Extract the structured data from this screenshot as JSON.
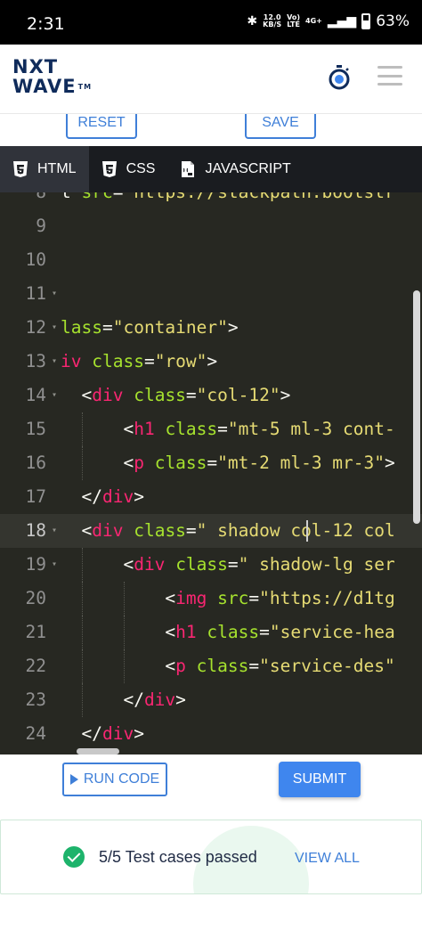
{
  "status_bar": {
    "time": "2:31",
    "net_speed_value": "12.0",
    "net_speed_unit": "KB/S",
    "volte_top": "Vo)",
    "volte_bottom": "LTE",
    "network": "4G+",
    "battery": "63%"
  },
  "header": {
    "logo_top": "NXT",
    "logo_bottom": "WAVE",
    "logo_tm": "TM"
  },
  "actions": {
    "reset_label": "RESET",
    "save_label": "SAVE"
  },
  "tabs": [
    {
      "label": "HTML",
      "icon": "html5-icon",
      "active": true
    },
    {
      "label": "CSS",
      "icon": "css3-icon",
      "active": false
    },
    {
      "label": "JAVASCRIPT",
      "icon": "js-file-icon",
      "active": false
    }
  ],
  "editor": {
    "lines": [
      {
        "num": "8",
        "fold": false,
        "text": "t src=\"https://stackpath.bootstr"
      },
      {
        "num": "9",
        "fold": false,
        "text": ""
      },
      {
        "num": "10",
        "fold": false,
        "text": ""
      },
      {
        "num": "11",
        "fold": true,
        "text": ""
      },
      {
        "num": "12",
        "fold": true,
        "text": "lass=\"container\">"
      },
      {
        "num": "13",
        "fold": true,
        "text": "iv class=\"row\">"
      },
      {
        "num": "14",
        "fold": true,
        "text": "  <div class=\"col-12\">"
      },
      {
        "num": "15",
        "fold": false,
        "text": "      <h1 class=\"mt-5 ml-3 cont-"
      },
      {
        "num": "16",
        "fold": false,
        "text": "      <p class=\"mt-2 ml-3 mr-3\">"
      },
      {
        "num": "17",
        "fold": false,
        "text": "  </div>"
      },
      {
        "num": "18",
        "fold": true,
        "text": "  <div class=\" shadow col-12 col"
      },
      {
        "num": "19",
        "fold": true,
        "text": "      <div class=\" shadow-lg ser"
      },
      {
        "num": "20",
        "fold": false,
        "text": "          <img src=\"https://d1tg"
      },
      {
        "num": "21",
        "fold": false,
        "text": "          <h1 class=\"service-hea"
      },
      {
        "num": "22",
        "fold": false,
        "text": "          <p class=\"service-des\""
      },
      {
        "num": "23",
        "fold": false,
        "text": "      </div>"
      },
      {
        "num": "24",
        "fold": false,
        "text": "  </div>"
      }
    ]
  },
  "run": {
    "run_label": "RUN CODE",
    "submit_label": "SUBMIT"
  },
  "result": {
    "text": "5/5 Test cases passed",
    "view_all": "VIEW ALL"
  },
  "colors": {
    "accent": "#3f7fd8",
    "submit": "#3f86ee",
    "success": "#1db36b",
    "editor_bg": "#272822",
    "tag": "#f92672",
    "attr": "#a6e22e",
    "string": "#e6db74"
  }
}
